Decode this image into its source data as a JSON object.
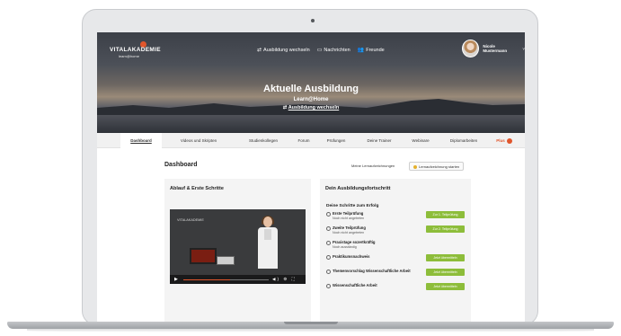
{
  "header": {
    "logo_text": "VITALAKADEMIE",
    "logo_sub": "learn@home",
    "nav": [
      {
        "icon": "switch-arrows-icon",
        "glyph": "⇄",
        "label": "Ausbildung wechseln"
      },
      {
        "icon": "message-icon",
        "glyph": "▭",
        "label": "Nachrichten"
      },
      {
        "icon": "friends-icon",
        "glyph": "👥",
        "label": "Freunde"
      }
    ],
    "user_name": "Nicole Mustermann",
    "user_chevron": "˅"
  },
  "hero": {
    "title": "Aktuelle Ausbildung",
    "subtitle": "Learn@Home",
    "switch_glyph": "⇄",
    "switch_label": "Ausbildung wechseln"
  },
  "tabs": [
    {
      "label": "Dashboard",
      "active": true
    },
    {
      "label": "Videos und Skripten"
    },
    {
      "label": "Studienkollegen"
    },
    {
      "label": "Forum"
    },
    {
      "label": "Prüfungen"
    },
    {
      "label": "Deine Trainer"
    },
    {
      "label": "Webinare"
    },
    {
      "label": "Diplomarbeiten"
    },
    {
      "label": "Plus"
    }
  ],
  "dashboard": {
    "title": "Dashboard",
    "my_recordings": "Meine Lernaufzeichnungen",
    "start_recording": "Lernaufzeichnung starten"
  },
  "intro_card": {
    "title": "Ablauf & Erste Schritte",
    "video_logo": "VITALAKADEMIE",
    "video_progress": 0.55,
    "play_glyph": "▶",
    "control_glyphs": "◀) ⚙ ⛶"
  },
  "progress_card": {
    "title": "Dein Ausbildungsfortschritt",
    "steps_heading": "Deine Schritte zum Erfolg",
    "steps": [
      {
        "title": "Erste Teilprüfung",
        "sub": "Noch nicht angetreten",
        "button": "Zur 1. Teilprüfung"
      },
      {
        "title": "Zweite Teilprüfung",
        "sub": "Noch nicht angetreten",
        "button": "Zur 2. Teilprüfung"
      },
      {
        "title": "Praxistage sozertkräftig",
        "sub": "Noch ausständig",
        "button": ""
      },
      {
        "title": "Praktikumsnachweis",
        "sub": "",
        "button": "Jetzt übermitteln"
      },
      {
        "title": "Themenvorschlag Wissenschaftliche Arbeit",
        "sub": "",
        "button": "Jetzt übermitteln"
      },
      {
        "title": "Wissenschaftliche Arbeit",
        "sub": "",
        "button": "Jetzt übermitteln"
      }
    ]
  },
  "colors": {
    "accent": "#e0562c",
    "button_green": "#8dbd3a"
  }
}
